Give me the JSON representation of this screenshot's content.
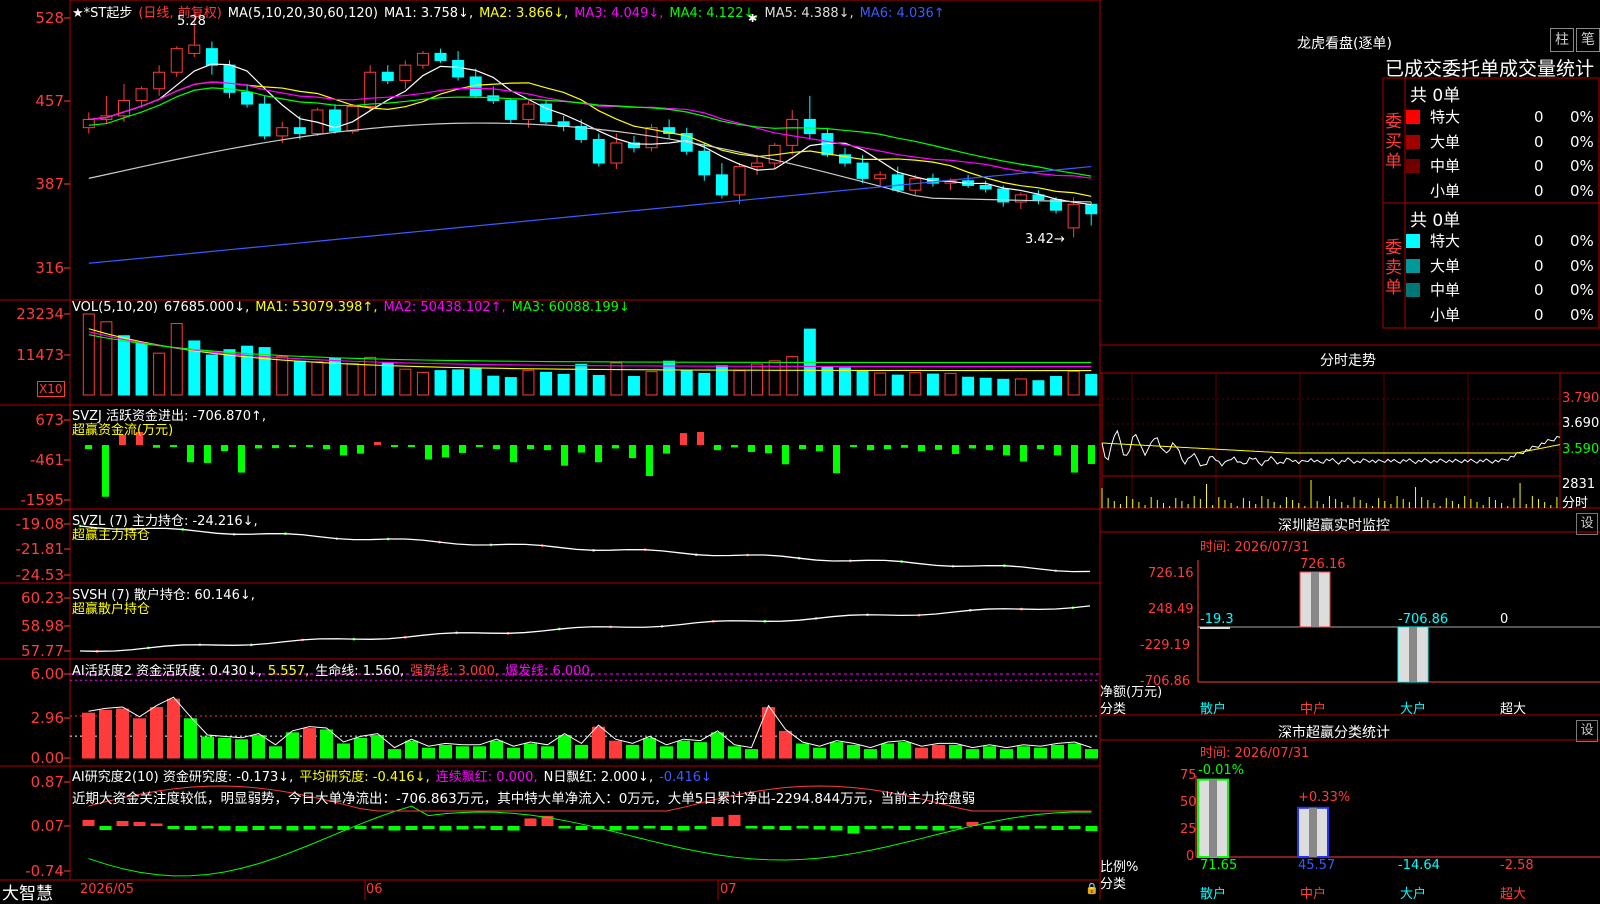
{
  "main": {
    "y_ticks": [
      "528",
      "457",
      "387",
      "316"
    ],
    "legend": [
      {
        "text": "★*ST起步",
        "color": "#ffffff"
      },
      {
        "text": "(日线, 前复权)",
        "color": "#ff3b3b"
      },
      {
        "text": "MA(5,10,20,30,60,120)",
        "color": "#ffffff"
      },
      {
        "text": "MA1: 3.758↓,",
        "color": "#ffffff"
      },
      {
        "text": "MA2: 3.866↓,",
        "color": "#ffff00"
      },
      {
        "text": "MA3: 4.049↓,",
        "color": "#ff00ff"
      },
      {
        "text": "MA4: 4.122↓,",
        "color": "#00ff00"
      },
      {
        "text": "MA5: 4.388↓,",
        "color": "#dddddd"
      },
      {
        "text": "MA6: 4.036↑",
        "color": "#3b5bff"
      }
    ],
    "high_note": "5.28",
    "low_note": "3.42→"
  },
  "vol": {
    "y_ticks": [
      "23234",
      "11473"
    ],
    "unit_badge": "X10",
    "legend": [
      {
        "text": "VOL(5,10,20)",
        "color": "#ffffff"
      },
      {
        "text": "67685.000↓,",
        "color": "#ffffff"
      },
      {
        "text": "MA1: 53079.398↑,",
        "color": "#ffff00"
      },
      {
        "text": "MA2: 50438.102↑,",
        "color": "#ff00ff"
      },
      {
        "text": "MA3: 60088.199↓",
        "color": "#00ff00"
      }
    ]
  },
  "svzj": {
    "y_ticks": [
      "673",
      "-461",
      "-1595"
    ],
    "legend": "SVZJ  活跃资金进出: -706.870↑,",
    "sub": "超赢资金流(万元)"
  },
  "svzl": {
    "y_ticks": [
      "-19.08",
      "-21.81",
      "-24.53"
    ],
    "legend": "SVZL (7) 主力持仓: -24.216↓,",
    "sub": "超赢主力持仓"
  },
  "svsh": {
    "y_ticks": [
      "60.23",
      "58.98",
      "57.77"
    ],
    "legend": "SVSH (7) 散户持仓: 60.146↓,",
    "sub": "超赢散户持仓"
  },
  "ai1": {
    "y_ticks": [
      "6.00",
      "2.96",
      "0.00"
    ],
    "legend": [
      {
        "text": "AI活跃度2 资金活跃度: 0.430↓,",
        "color": "#ffffff"
      },
      {
        "text": "5.557,",
        "color": "#ffff00"
      },
      {
        "text": "生命线: 1.560,",
        "color": "#ffffff"
      },
      {
        "text": "强势线: 3.000,",
        "color": "#ff3b3b"
      },
      {
        "text": "爆发线: 6.000,",
        "color": "#ff00ff"
      }
    ]
  },
  "ai2": {
    "y_ticks": [
      "0.87",
      "0.07",
      "-0.74"
    ],
    "legend": [
      {
        "text": "AI研究度2(10) 资金研究度: -0.173↓,",
        "color": "#ffffff"
      },
      {
        "text": "平均研究度: -0.416↓,",
        "color": "#ffff00"
      },
      {
        "text": "连续飘红: 0.000,",
        "color": "#ff00ff"
      },
      {
        "text": "N日飘红: 2.000↓,",
        "color": "#ffffff"
      },
      {
        "text": "-0.416↓",
        "color": "#3b5bff"
      }
    ],
    "comment": "近期大资金关注度较低，明显弱势，今日大单净流出：-706.863万元，其中特大单净流入：0万元，大单5日累计净出-2294.844万元，当前主力控盘弱"
  },
  "xaxis": {
    "brand": "大智慧",
    "labels": [
      "2026/05",
      "06",
      "07"
    ]
  },
  "side": {
    "lhb_title": "龙虎看盘(逐单)",
    "btn_bar": "柱",
    "btn_bi": "笔",
    "table_title": "已成交委托单成交量统计",
    "buy_label": "委买单",
    "sell_label": "委卖单",
    "buy_total": "共 0单",
    "sell_total": "共 0单",
    "buy_rows": [
      {
        "name": "特大",
        "vol": "0",
        "pct": "0%",
        "color": "#ff0000"
      },
      {
        "name": "大单",
        "vol": "0",
        "pct": "0%",
        "color": "#a00000"
      },
      {
        "name": "中单",
        "vol": "0",
        "pct": "0%",
        "color": "#700000"
      },
      {
        "name": "小单",
        "vol": "0",
        "pct": "0%",
        "color": "#000000"
      }
    ],
    "sell_rows": [
      {
        "name": "特大",
        "vol": "0",
        "pct": "0%",
        "color": "#00ffff"
      },
      {
        "name": "大单",
        "vol": "0",
        "pct": "0%",
        "color": "#009999"
      },
      {
        "name": "中单",
        "vol": "0",
        "pct": "0%",
        "color": "#007777"
      },
      {
        "name": "小单",
        "vol": "0",
        "pct": "0%",
        "color": "#000000"
      }
    ],
    "intraday_title": "分时走势",
    "intraday_ticks": [
      "3.790",
      "3.690",
      "3.590",
      "2831"
    ],
    "intraday_unit": "分时",
    "monitor_title": "深圳超赢实时监控",
    "monitor_btn": "设",
    "monitor_time": "时间: 2026/07/31",
    "monitor_y_ticks": [
      "726.16",
      "248.49",
      "-229.19",
      "-706.86"
    ],
    "monitor_values": [
      "-19.3",
      "726.16",
      "-706.86",
      "0"
    ],
    "monitor_unit": "净额(万元)",
    "monitor_cat_label": "分类",
    "monitor_cats": [
      "散户",
      "中户",
      "大户",
      "超大"
    ],
    "class_title": "深市超赢分类统计",
    "class_btn": "设",
    "class_time": "时间: 2026/07/31",
    "class_y_ticks": [
      "75",
      "50",
      "25",
      "0"
    ],
    "class_top": [
      "-0.01%",
      "+0.33%"
    ],
    "class_values": [
      "71.65",
      "45.57",
      "-14.64",
      "-2.58"
    ],
    "class_unit": "比例%",
    "class_cat_label": "分类",
    "class_cats": [
      "散户",
      "中户",
      "大户",
      "超大"
    ]
  },
  "chart_data": [
    {
      "type": "candlestick",
      "title": "★*ST起步",
      "series_note": "日线, 前复权",
      "ylim": [
        3.1,
        5.4
      ],
      "y_ticks": [
        5.28,
        4.57,
        3.87,
        3.16
      ],
      "ohlc": [
        [
          4.35,
          4.48,
          4.3,
          4.42
        ],
        [
          4.42,
          4.62,
          4.38,
          4.45
        ],
        [
          4.45,
          4.72,
          4.4,
          4.58
        ],
        [
          4.58,
          4.7,
          4.52,
          4.68
        ],
        [
          4.68,
          4.88,
          4.62,
          4.82
        ],
        [
          4.82,
          5.04,
          4.78,
          5.02
        ],
        [
          4.98,
          5.28,
          4.95,
          5.05
        ],
        [
          5.02,
          5.08,
          4.8,
          4.88
        ],
        [
          4.88,
          4.92,
          4.6,
          4.65
        ],
        [
          4.65,
          4.72,
          4.52,
          4.55
        ],
        [
          4.55,
          4.62,
          4.25,
          4.28
        ],
        [
          4.28,
          4.4,
          4.22,
          4.35
        ],
        [
          4.35,
          4.45,
          4.25,
          4.3
        ],
        [
          4.3,
          4.52,
          4.28,
          4.5
        ],
        [
          4.5,
          4.55,
          4.3,
          4.32
        ],
        [
          4.32,
          4.55,
          4.3,
          4.53
        ],
        [
          4.53,
          4.88,
          4.5,
          4.82
        ],
        [
          4.82,
          4.88,
          4.72,
          4.75
        ],
        [
          4.75,
          4.92,
          4.68,
          4.88
        ],
        [
          4.88,
          5.0,
          4.85,
          4.98
        ],
        [
          4.98,
          5.02,
          4.9,
          4.92
        ],
        [
          4.92,
          5.0,
          4.75,
          4.78
        ],
        [
          4.78,
          4.85,
          4.6,
          4.62
        ],
        [
          4.62,
          4.7,
          4.55,
          4.58
        ],
        [
          4.58,
          4.6,
          4.38,
          4.42
        ],
        [
          4.42,
          4.58,
          4.35,
          4.55
        ],
        [
          4.55,
          4.58,
          4.38,
          4.4
        ],
        [
          4.4,
          4.45,
          4.32,
          4.36
        ],
        [
          4.36,
          4.42,
          4.22,
          4.25
        ],
        [
          4.25,
          4.3,
          4.02,
          4.05
        ],
        [
          4.05,
          4.3,
          4.0,
          4.22
        ],
        [
          4.22,
          4.28,
          4.14,
          4.18
        ],
        [
          4.18,
          4.38,
          4.15,
          4.35
        ],
        [
          4.35,
          4.42,
          4.25,
          4.3
        ],
        [
          4.3,
          4.35,
          4.12,
          4.15
        ],
        [
          4.15,
          4.22,
          3.9,
          3.95
        ],
        [
          3.95,
          4.05,
          3.75,
          3.78
        ],
        [
          3.78,
          4.05,
          3.7,
          4.02
        ],
        [
          4.02,
          4.12,
          3.95,
          4.05
        ],
        [
          4.05,
          4.22,
          4.0,
          4.2
        ],
        [
          4.2,
          4.5,
          4.12,
          4.42
        ],
        [
          4.42,
          4.62,
          4.25,
          4.3
        ],
        [
          4.3,
          4.35,
          4.1,
          4.12
        ],
        [
          4.12,
          4.18,
          4.02,
          4.05
        ],
        [
          4.05,
          4.12,
          3.88,
          3.92
        ],
        [
          3.92,
          3.98,
          3.85,
          3.95
        ],
        [
          3.95,
          4.02,
          3.8,
          3.82
        ],
        [
          3.82,
          3.95,
          3.78,
          3.92
        ],
        [
          3.92,
          3.96,
          3.85,
          3.88
        ],
        [
          3.88,
          3.92,
          3.82,
          3.9
        ],
        [
          3.9,
          3.95,
          3.84,
          3.86
        ],
        [
          3.86,
          3.9,
          3.8,
          3.83
        ],
        [
          3.83,
          3.86,
          3.68,
          3.72
        ],
        [
          3.72,
          3.8,
          3.66,
          3.78
        ],
        [
          3.78,
          3.82,
          3.7,
          3.74
        ],
        [
          3.74,
          3.76,
          3.62,
          3.65
        ],
        [
          3.5,
          3.76,
          3.42,
          3.7
        ],
        [
          3.7,
          3.72,
          3.52,
          3.62
        ]
      ]
    },
    {
      "type": "bar",
      "title": "VOL(5,10,20)",
      "values": [
        23234,
        21000,
        17000,
        15000,
        12000,
        20500,
        15500,
        11473,
        13000,
        14000,
        13600,
        11000,
        9700,
        9500,
        10500,
        9000,
        10800,
        9200,
        7400,
        6500,
        7000,
        7200,
        7500,
        5400,
        5000,
        7100,
        6500,
        5900,
        8800,
        5600,
        9200,
        5300,
        6700,
        9700,
        6900,
        6200,
        8400,
        7000,
        8900,
        9800,
        11000,
        18900,
        8200,
        7800,
        7000,
        6300,
        5700,
        6400,
        6000,
        6200,
        5100,
        4800,
        4500,
        4600,
        4100,
        5300,
        6800,
        5900
      ],
      "up_flags": [
        1,
        1,
        0,
        0,
        1,
        1,
        0,
        0,
        0,
        0,
        0,
        1,
        0,
        1,
        0,
        1,
        1,
        0,
        1,
        1,
        0,
        0,
        0,
        0,
        0,
        1,
        0,
        0,
        0,
        0,
        1,
        0,
        1,
        0,
        0,
        0,
        0,
        1,
        1,
        1,
        1,
        0,
        0,
        0,
        0,
        1,
        0,
        1,
        0,
        1,
        0,
        0,
        0,
        1,
        0,
        0,
        1,
        0
      ]
    },
    {
      "type": "bar",
      "title": "SVZJ 活跃资金进出",
      "ylim": [
        -1595,
        673
      ],
      "values": [
        -120,
        -1500,
        280,
        350,
        -80,
        -60,
        -500,
        -520,
        -180,
        -800,
        -100,
        -90,
        -40,
        -60,
        -120,
        -300,
        -250,
        80,
        -60,
        -50,
        -420,
        -360,
        -230,
        -60,
        -120,
        -500,
        -120,
        -150,
        -600,
        -220,
        -500,
        -100,
        -380,
        -900,
        -250,
        320,
        350,
        -150,
        -70,
        -200,
        -240,
        -560,
        -120,
        -180,
        -820,
        -60,
        -150,
        -120,
        -80,
        -180,
        -140,
        -260,
        -100,
        -150,
        -300,
        -480,
        -120,
        -300,
        -800,
        -550
      ],
      "up_flags": [
        0,
        0,
        1,
        1,
        0,
        0,
        0,
        0,
        0,
        0,
        0,
        0,
        0,
        0,
        0,
        0,
        0,
        1,
        0,
        0,
        0,
        0,
        0,
        0,
        0,
        0,
        0,
        0,
        0,
        0,
        0,
        0,
        0,
        0,
        0,
        1,
        1,
        0,
        0,
        0,
        0,
        0,
        0,
        0,
        0,
        0,
        0,
        0,
        0,
        0,
        0,
        0,
        0,
        0,
        0,
        0,
        0,
        0,
        0,
        0
      ]
    },
    {
      "type": "line",
      "title": "SVZL 主力持仓",
      "ylim": [
        -24.53,
        -19.08
      ],
      "last": -24.216
    },
    {
      "type": "line",
      "title": "SVSH 散户持仓",
      "ylim": [
        57.77,
        60.23
      ],
      "last": 60.146
    },
    {
      "type": "bar",
      "title": "AI活跃度2 资金活跃度",
      "ylim": [
        0,
        6.0
      ],
      "values": [
        3.2,
        3.4,
        3.5,
        2.8,
        3.6,
        4.2,
        2.8,
        1.5,
        1.4,
        1.3,
        1.6,
        0.8,
        1.8,
        2.1,
        2.0,
        1.0,
        1.4,
        1.6,
        0.6,
        1.2,
        0.7,
        0.9,
        0.8,
        0.8,
        1.2,
        0.7,
        1.0,
        0.8,
        1.6,
        0.9,
        2.2,
        1.2,
        0.9,
        1.4,
        0.8,
        1.2,
        1.1,
        1.8,
        0.8,
        0.6,
        3.6,
        1.9,
        1.0,
        0.7,
        1.1,
        0.9,
        0.6,
        1.0,
        1.1,
        0.7,
        0.9,
        0.9,
        0.6,
        0.8,
        0.6,
        0.8,
        0.7,
        0.9,
        1.0,
        0.6
      ],
      "up_flags": [
        1,
        1,
        1,
        1,
        1,
        1,
        0,
        0,
        0,
        0,
        0,
        0,
        0,
        1,
        0,
        0,
        0,
        0,
        0,
        0,
        0,
        0,
        0,
        0,
        0,
        0,
        0,
        0,
        0,
        0,
        1,
        1,
        0,
        0,
        0,
        0,
        0,
        0,
        0,
        0,
        1,
        1,
        0,
        0,
        0,
        0,
        0,
        0,
        0,
        1,
        1,
        0,
        0,
        0,
        0,
        0,
        0,
        0,
        0,
        0
      ],
      "ref_lines": {
        "生命线": 1.56,
        "强势线": 3.0,
        "爆发线": 6.0
      }
    },
    {
      "type": "bar",
      "title": "AI研究度2(10) 资金研究度",
      "ylim": [
        -0.74,
        0.87
      ],
      "values": [
        0.12,
        -0.08,
        0.1,
        0.08,
        0.05,
        -0.06,
        -0.08,
        -0.05,
        -0.09,
        -0.1,
        -0.08,
        -0.06,
        -0.09,
        -0.07,
        -0.05,
        -0.08,
        -0.06,
        -0.05,
        -0.09,
        -0.08,
        -0.06,
        -0.09,
        -0.07,
        -0.05,
        -0.08,
        -0.09,
        0.15,
        0.2,
        -0.05,
        -0.08,
        -0.06,
        -0.09,
        -0.07,
        -0.05,
        -0.08,
        -0.09,
        -0.06,
        0.18,
        0.22,
        -0.05,
        -0.06,
        -0.08,
        -0.05,
        -0.07,
        -0.09,
        -0.15,
        -0.06,
        -0.05,
        -0.08,
        -0.06,
        -0.09,
        -0.05,
        0.08,
        -0.06,
        -0.09,
        -0.07,
        -0.05,
        -0.08,
        -0.06,
        -0.1
      ],
      "up_flags": [
        1,
        0,
        1,
        1,
        1,
        0,
        0,
        0,
        0,
        0,
        0,
        0,
        0,
        0,
        0,
        0,
        0,
        0,
        0,
        0,
        0,
        0,
        0,
        0,
        0,
        0,
        1,
        1,
        0,
        0,
        0,
        0,
        0,
        0,
        0,
        0,
        0,
        1,
        1,
        0,
        0,
        0,
        0,
        0,
        0,
        0,
        0,
        0,
        0,
        0,
        0,
        0,
        1,
        0,
        0,
        0,
        0,
        0,
        0,
        0
      ]
    }
  ]
}
